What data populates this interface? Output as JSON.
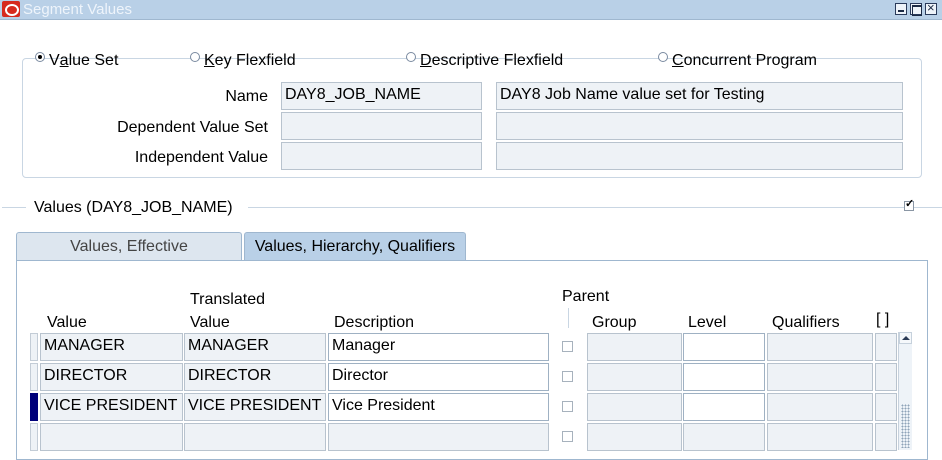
{
  "window": {
    "title": "Segment Values",
    "controls": [
      "minimize-icon",
      "maximize-icon",
      "close-icon"
    ]
  },
  "radios": [
    {
      "pre": "V",
      "ul": "a",
      "post": "lue Set",
      "selected": true
    },
    {
      "pre": "",
      "ul": "K",
      "post": "ey Flexfield",
      "selected": false
    },
    {
      "pre": "",
      "ul": "D",
      "post": "escriptive Flexfield",
      "selected": false
    },
    {
      "pre": "",
      "ul": "C",
      "post": "oncurrent Program",
      "selected": false
    }
  ],
  "fields": {
    "name_label": "Name",
    "name_value": "DAY8_JOB_NAME",
    "name_description": "DAY8 Job Name value set for Testing",
    "dependent_label": "Dependent Value Set",
    "dependent_value": "",
    "dependent_description": "",
    "independent_label": "Independent Value",
    "independent_value": "",
    "independent_description": ""
  },
  "values_section": {
    "title": "Values (DAY8_JOB_NAME)",
    "checked": true
  },
  "tabs": [
    {
      "label": "Values, Effective",
      "active": false
    },
    {
      "label": "Values, Hierarchy, Qualifiers",
      "active": true
    }
  ],
  "table": {
    "headers": {
      "value": "Value",
      "translated_top": "Translated",
      "translated_bottom": "Value",
      "description": "Description",
      "parent": "Parent",
      "group": "Group",
      "level": "Level",
      "qualifiers": "Qualifiers",
      "brackets": "[ ]"
    },
    "rows": [
      {
        "value": "MANAGER",
        "translated": "MANAGER",
        "description": "Manager",
        "group": "",
        "level": "",
        "qualifiers": "",
        "current": false
      },
      {
        "value": "DIRECTOR",
        "translated": "DIRECTOR",
        "description": "Director",
        "group": "",
        "level": "",
        "qualifiers": "",
        "current": false
      },
      {
        "value": "VICE PRESIDENT",
        "translated": "VICE PRESIDENT",
        "description": "Vice President",
        "group": "",
        "level": "",
        "qualifiers": "",
        "current": true
      },
      {
        "value": "",
        "translated": "",
        "description": "",
        "group": "",
        "level": "",
        "qualifiers": "",
        "current": false
      }
    ]
  },
  "colors": {
    "titlebar": "#b9d0e7",
    "active_tab": "#b9d0e7",
    "current_record": "#00007a",
    "readonly_field": "#eef2f6"
  }
}
